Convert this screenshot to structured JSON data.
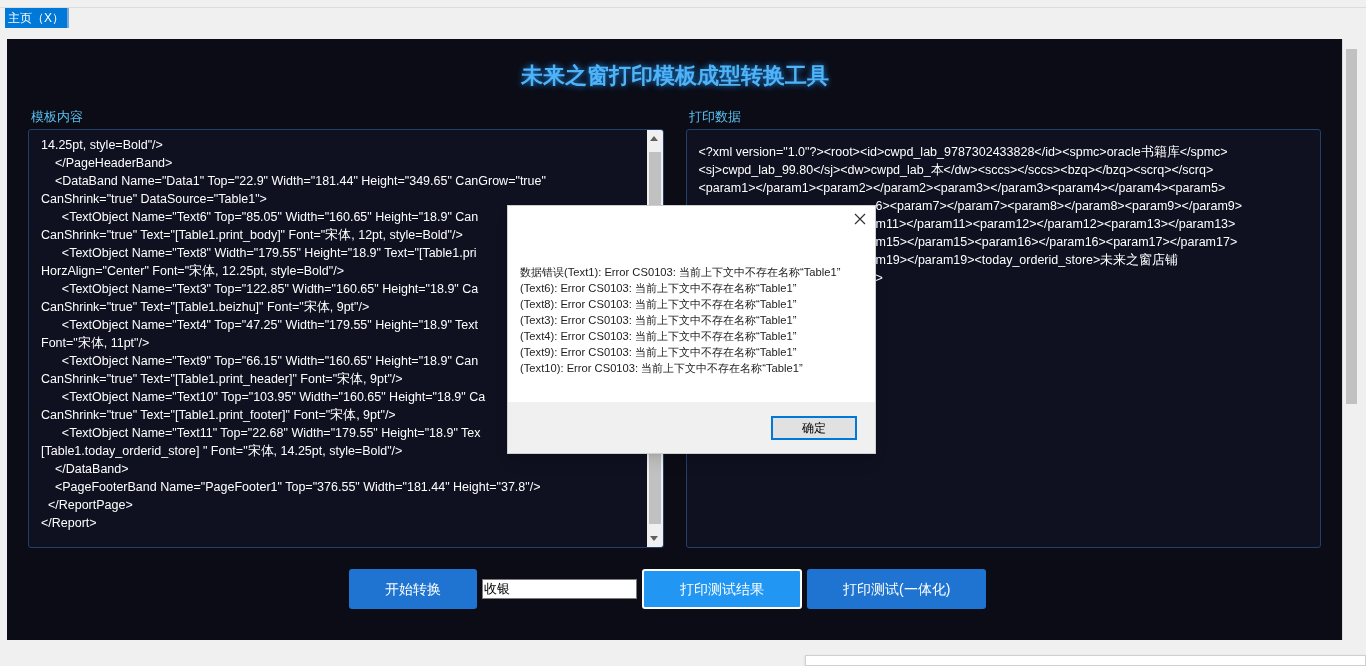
{
  "tabs": [
    {
      "label": "主页（X）",
      "selected": true
    }
  ],
  "title": "未来之窗打印模板成型转换工具",
  "template_panel": {
    "label": "模板内容",
    "lines": [
      {
        "text": "14.25pt, style=Bold\"/>"
      },
      {
        "text": "    </PageHeaderBand>"
      },
      {
        "text": "    <DataBand Name=\"Data1\" Top=\"22.9\" Width=\"181.44\" Height=\"349.65\" CanGrow=\"true\""
      },
      {
        "text": "CanShrink=\"true\" DataSource=\"Table1\">"
      },
      {
        "text": "      <TextObject Name=\"Text6\" Top=\"85.05\" Width=\"160.65\" Height=\"18.9\" Can"
      },
      {
        "text": "CanShrink=\"true\" Text=\"[Table1.print_body]\" Font=\"宋体, 12pt, style=Bold\"/>"
      },
      {
        "text": "      <TextObject Name=\"Text8\" Width=\"179.55\" Height=\"18.9\" Text=\"[Table1.pri"
      },
      {
        "text": "HorzAlign=\"Center\" Font=\"宋体, 12.25pt, style=Bold\"/>"
      },
      {
        "text": "      <TextObject Name=\"Text3\" Top=\"122.85\" Width=\"160.65\" Height=\"18.9\" Ca"
      },
      {
        "text": "CanShrink=\"true\" Text=\"[Table1.beizhu]\" Font=\"宋体, 9pt\"/>"
      },
      {
        "text": "      <TextObject Name=\"Text4\" Top=\"47.25\" Width=\"179.55\" Height=\"18.9\" Text"
      },
      {
        "text": "Font=\"宋体, 11pt\"/>"
      },
      {
        "text": "      <TextObject Name=\"Text9\" Top=\"66.15\" Width=\"160.65\" Height=\"18.9\" Can"
      },
      {
        "text": "CanShrink=\"true\" Text=\"[Table1.print_header]\" Font=\"宋体, 9pt\"/>"
      },
      {
        "text": "      <TextObject Name=\"Text10\" Top=\"103.95\" Width=\"160.65\" Height=\"18.9\" Ca"
      },
      {
        "text": "CanShrink=\"true\" Text=\"[Table1.print_footer]\" Font=\"宋体, 9pt\"/>"
      },
      {
        "text": "      <TextObject Name=\"Text11\" Top=\"22.68\" Width=\"179.55\" Height=\"18.9\" Tex"
      },
      {
        "text": "[Table1.today_orderid_store] \" Font=\"宋体, 14.25pt, style=Bold\"/>"
      },
      {
        "text": "    </DataBand>"
      },
      {
        "text": "    <PageFooterBand Name=\"PageFooter1\" Top=\"376.55\" Width=\"181.44\" Height=\"37.8\"/>"
      },
      {
        "text": "  </ReportPage>"
      },
      {
        "text": "</Report>"
      }
    ]
  },
  "print_panel": {
    "label": "打印数据",
    "lines": [
      {
        "text": "<?xml version=\"1.0\"?><root><id>cwpd_lab_9787302433828</id><spmc>oracle书籍库</spmc>",
        "covered": false
      },
      {
        "text": "<sj>cwpd_lab_99.80</sj><dw>cwpd_lab_本</dw><sccs></sccs><bzq></bzq><scrq></scrq>",
        "covered": false
      },
      {
        "text": "<param1></param1><param2></param2><param3></param3><param4></param4><param5>",
        "covered": false
      },
      {
        "text": "6><param7></param7><param8></param8><param9></param9>",
        "covered": true
      },
      {
        "text": "m11></param11><param12></param12><param13></param13>",
        "covered": true
      },
      {
        "text": "m15></param15><param16></param16><param17></param17>",
        "covered": true
      },
      {
        "text": "m19></param19><today_orderid_store>未来之窗店铺",
        "covered": true
      },
      {
        "text": ">",
        "covered": true
      }
    ]
  },
  "actions": [
    {
      "kind": "button",
      "label": "开始转换",
      "focused": false
    },
    {
      "kind": "field",
      "value": "收银"
    },
    {
      "kind": "button",
      "label": "打印测试结果",
      "focused": true
    },
    {
      "kind": "button",
      "label": "打印测试(一体化)",
      "focused": false
    }
  ],
  "dialog": {
    "lines": [
      "数据错误(Text1): Error CS0103: 当前上下文中不存在名称“Table1”",
      "(Text6): Error CS0103: 当前上下文中不存在名称“Table1”",
      "(Text8): Error CS0103: 当前上下文中不存在名称“Table1”",
      "(Text3): Error CS0103: 当前上下文中不存在名称“Table1”",
      "(Text4): Error CS0103: 当前上下文中不存在名称“Table1”",
      "(Text9): Error CS0103: 当前上下文中不存在名称“Table1”",
      "(Text10): Error CS0103: 当前上下文中不存在名称“Table1”"
    ],
    "ok_button": "确定"
  }
}
